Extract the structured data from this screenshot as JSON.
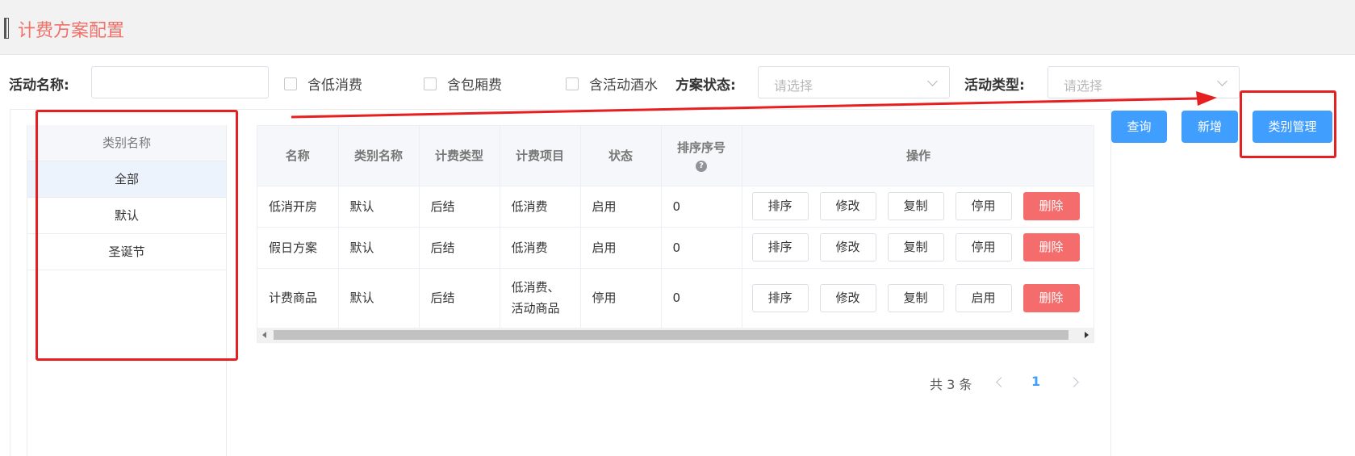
{
  "header": {
    "title": "计费方案配置"
  },
  "filters": {
    "activity_name_label": "活动名称:",
    "activity_name_value": "",
    "checkbox_low_consumption": "含低消费",
    "checkbox_room_fee": "含包厢费",
    "checkbox_activity_drinks": "含活动酒水",
    "plan_status_label": "方案状态:",
    "plan_status_placeholder": "请选择",
    "activity_type_label": "活动类型:",
    "activity_type_placeholder": "请选择"
  },
  "actions": {
    "query": "查询",
    "add": "新增",
    "category_manage": "类别管理"
  },
  "categories": {
    "header": "类别名称",
    "items": [
      "全部",
      "默认",
      "圣诞节"
    ],
    "selected": "全部"
  },
  "table": {
    "columns": [
      "名称",
      "类别名称",
      "计费类型",
      "计费项目",
      "状态",
      "排序序号",
      "操作"
    ],
    "sort_help_icon": "?",
    "rows": [
      {
        "name": "低消开房",
        "category": "默认",
        "billing_type": "后结",
        "billing_item": "低消费",
        "status": "启用",
        "sort": "0",
        "ops": [
          "排序",
          "修改",
          "复制",
          "停用",
          "删除"
        ]
      },
      {
        "name": "假日方案",
        "category": "默认",
        "billing_type": "后结",
        "billing_item": "低消费",
        "status": "启用",
        "sort": "0",
        "ops": [
          "排序",
          "修改",
          "复制",
          "停用",
          "删除"
        ]
      },
      {
        "name": "计费商品",
        "category": "默认",
        "billing_type": "后结",
        "billing_item_line1": "低消费、",
        "billing_item_line2": "活动商品",
        "status": "停用",
        "sort": "0",
        "ops": [
          "排序",
          "修改",
          "复制",
          "启用",
          "删除"
        ]
      }
    ]
  },
  "pagination": {
    "total_text": "共 3 条",
    "current_page": "1"
  },
  "colors": {
    "title": "#f0716a",
    "primary": "#409eff",
    "danger": "#f56c6c",
    "annotation": "#e62020"
  },
  "icons": {
    "dropdown": "chevron-down-icon",
    "prev": "chevron-left-icon",
    "next": "chevron-right-icon",
    "help": "question-circle-icon"
  }
}
